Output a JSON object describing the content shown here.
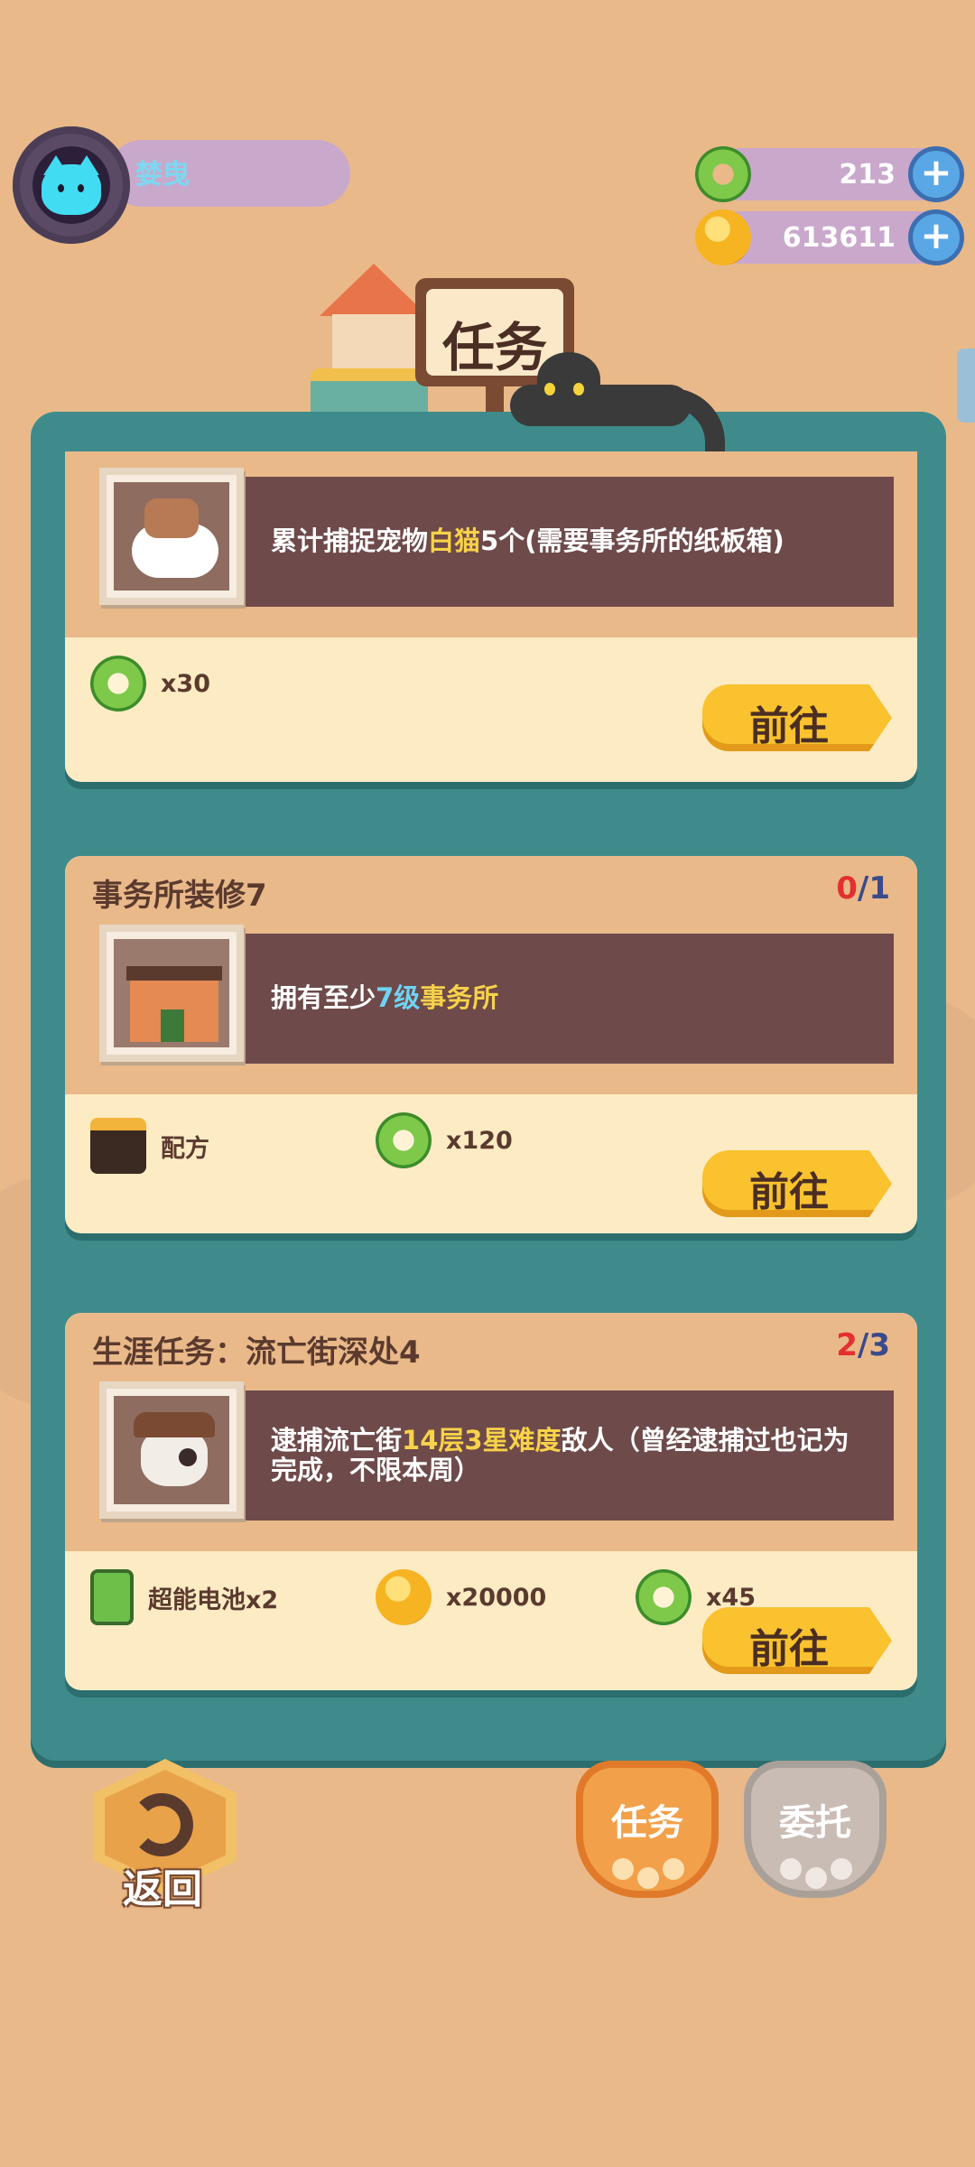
{
  "player": {
    "name": "婪曳"
  },
  "resources": [
    {
      "icon": "donut-icon",
      "value": "213"
    },
    {
      "icon": "coin-icon",
      "value": "613611"
    }
  ],
  "header": {
    "title": "任务"
  },
  "tasks": [
    {
      "title": "",
      "progress_current": "",
      "progress_total": "",
      "desc_parts": [
        "累计捕捉宠物",
        "白猫",
        "5个(需要事务所的纸板箱)"
      ],
      "thumb": "cat-pet-icon",
      "rewards": [
        {
          "icon": "donut-icon",
          "label": "x30"
        }
      ],
      "button": "前往"
    },
    {
      "title": "事务所装修7",
      "progress_current": "0",
      "progress_total": "1",
      "desc_parts": [
        "拥有至少",
        "7级",
        "事务所"
      ],
      "thumb": "office-building-icon",
      "rewards": [
        {
          "icon": "toolbox-icon",
          "label": "配方"
        },
        {
          "icon": "donut-icon",
          "label": "x120"
        }
      ],
      "button": "前往"
    },
    {
      "title": "生涯任务：流亡街深处4",
      "progress_current": "2",
      "progress_total": "3",
      "desc_parts": [
        "逮捕流亡街",
        "14层3星难度",
        "敌人（曾经逮捕过也记为完成，不限本周）"
      ],
      "thumb": "pirate-skull-icon",
      "rewards": [
        {
          "icon": "battery-icon",
          "label": "超能电池x2"
        },
        {
          "icon": "coin-icon",
          "label": "x20000"
        },
        {
          "icon": "donut-icon",
          "label": "x45"
        }
      ],
      "button": "前往"
    }
  ],
  "bottom": {
    "back_label": "返回",
    "tab_tasks": "任务",
    "tab_commission": "委托"
  },
  "colors": {
    "panel": "#3f8b8c",
    "card": "#fdebc4",
    "desc_bar": "#6e4a4a",
    "button": "#f9c22e",
    "highlight": "#f7d24a"
  }
}
